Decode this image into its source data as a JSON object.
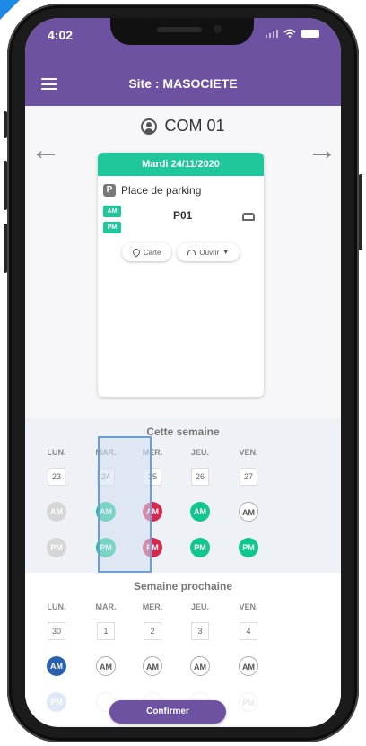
{
  "status_bar": {
    "time": "4:02"
  },
  "app_bar": {
    "title": "Site : MASOCIETE"
  },
  "user": {
    "name": "COM 01"
  },
  "booking_card": {
    "date_label": "Mardi 24/11/2020",
    "resource_type": "Place de parking",
    "slot_tags": [
      "AM",
      "PM"
    ],
    "spot_code": "P01",
    "map_button": "Carte",
    "open_button": "Ouvrir"
  },
  "this_week": {
    "title": "Cette semaine",
    "days": [
      {
        "label": "LUN.",
        "date": "23",
        "am": "AM",
        "pm": "PM",
        "am_state": "grey",
        "pm_state": "grey"
      },
      {
        "label": "MAR.",
        "date": "24",
        "am": "AM",
        "pm": "PM",
        "am_state": "green",
        "pm_state": "green",
        "selected": true
      },
      {
        "label": "MER.",
        "date": "25",
        "am": "AM",
        "pm": "PM",
        "am_state": "red",
        "pm_state": "red"
      },
      {
        "label": "JEU.",
        "date": "26",
        "am": "AM",
        "pm": "PM",
        "am_state": "green",
        "pm_state": "green"
      },
      {
        "label": "VEN.",
        "date": "27",
        "am": "AM",
        "pm": "PM",
        "am_state": "white",
        "pm_state": "green"
      }
    ]
  },
  "next_week": {
    "title": "Semaine prochaine",
    "days": [
      {
        "label": "LUN.",
        "date": "30",
        "am": "AM",
        "pm": "PM",
        "am_state": "blue",
        "pm_state": "lightblue"
      },
      {
        "label": "MAR.",
        "date": "1",
        "am": "AM",
        "pm": "",
        "am_state": "white",
        "pm_state": "faded"
      },
      {
        "label": "MER.",
        "date": "2",
        "am": "AM",
        "pm": "",
        "am_state": "white",
        "pm_state": "faded"
      },
      {
        "label": "JEU.",
        "date": "3",
        "am": "AM",
        "pm": "PM",
        "am_state": "white",
        "pm_state": "faded"
      },
      {
        "label": "VEN.",
        "date": "4",
        "am": "AM",
        "pm": "PM",
        "am_state": "white",
        "pm_state": "faded"
      }
    ]
  },
  "confirm_button": "Confirmer",
  "colors": {
    "brand_purple": "#6c52a0",
    "available_green": "#10c78f",
    "booked_red": "#d6284e",
    "selected_blue": "#2a60b0"
  }
}
